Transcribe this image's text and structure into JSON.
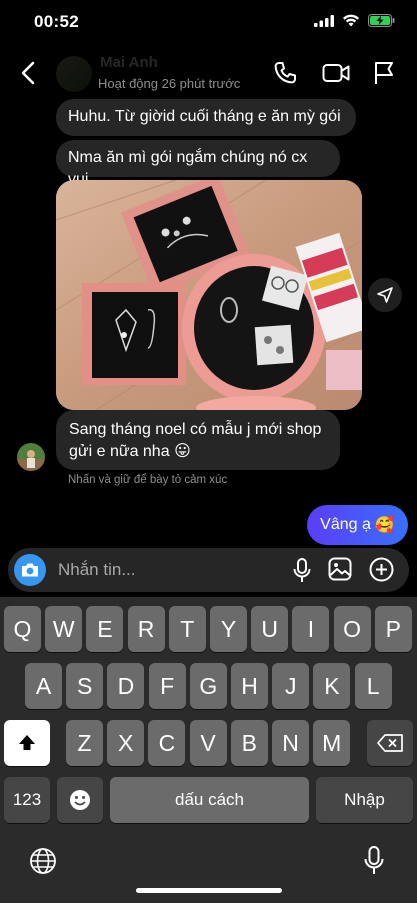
{
  "status": {
    "time": "00:52"
  },
  "header": {
    "name": "Mai Anh",
    "status": "Hoạt động 26 phút trước"
  },
  "messages": [
    {
      "text": "Huhu. Từ giờid cuối tháng e ăn mỳ gói"
    },
    {
      "text": "Nma ăn mì gói ngắm chúng nó cx vui"
    },
    {
      "line1": "Sang tháng noel có mẫu j mới shop",
      "line2": "gửi e nữa nha",
      "emoji": "😛"
    }
  ],
  "hint": "Nhấn và giữ để bày tỏ cảm xúc",
  "sent": {
    "text": "Vâng ạ",
    "emoji": "🥰"
  },
  "composer": {
    "placeholder": "Nhắn tin..."
  },
  "keyboard": {
    "row1": [
      "Q",
      "W",
      "E",
      "R",
      "T",
      "Y",
      "U",
      "I",
      "O",
      "P"
    ],
    "row2": [
      "A",
      "S",
      "D",
      "F",
      "G",
      "H",
      "J",
      "K",
      "L"
    ],
    "row3": [
      "Z",
      "X",
      "C",
      "V",
      "B",
      "N",
      "M"
    ],
    "numbers": "123",
    "space": "dấu cách",
    "return": "Nhập"
  },
  "colors": {
    "accent": "#3797f0",
    "sent_start": "#5b3df5",
    "sent_end": "#3870ff",
    "bubble": "#262626"
  }
}
